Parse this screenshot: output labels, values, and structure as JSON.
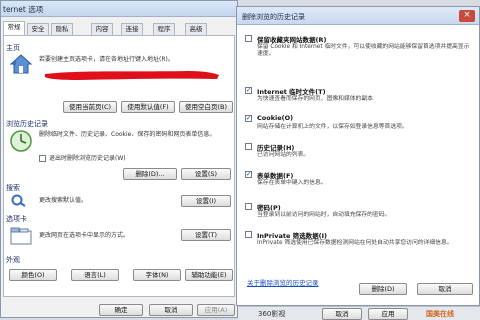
{
  "colors": {
    "desktop": "#d6dbe4",
    "window_bg": "#f0f0f0",
    "dialog_bg": "#ffffff",
    "title_bar": "#cfe0f5",
    "close_red": "#c74a3e",
    "red_scribble": "#e0101a",
    "link": "#1a4fbf",
    "taskbar": "#e4e7ec",
    "watermark": "#d1641f"
  },
  "options_window": {
    "title": "ternet 选项",
    "tabs": [
      "常规",
      "安全",
      "隐私",
      "内容",
      "连接",
      "程序",
      "高级"
    ],
    "home_page": {
      "label": "主页",
      "hint": "若要创建主页选项卡，请在各地址行键入地址(R)。",
      "buttons": [
        "使用当前页(C)",
        "使用默认值(F)",
        "使用空白页(B)"
      ]
    },
    "history": {
      "label": "浏览历史记录",
      "desc": "删除临时文件、历史记录、Cookie、保存的密码和网页表单信息。",
      "checkbox_label": "退出时删除浏览历史记录(W)",
      "checkbox_checked": false,
      "buttons": [
        "删除(D)...",
        "设置(S)"
      ]
    },
    "search": {
      "label": "搜索",
      "desc": "更改搜索默认值。",
      "button": "设置(I)"
    },
    "tabs_section": {
      "label": "选项卡",
      "desc": "更改网页在选项卡中显示的方式。",
      "button": "设置(T)"
    },
    "appearance": {
      "label": "外观",
      "buttons": [
        "颜色(O)",
        "语言(L)",
        "字体(N)",
        "辅助功能(E)"
      ]
    },
    "footer_buttons": [
      "确定",
      "取消",
      "应用(A)"
    ]
  },
  "delete_dialog": {
    "title": "删除浏览的历史记录",
    "close_glyph": "×",
    "options": [
      {
        "title": "保留收藏夹网站数据(R)",
        "desc": "保留 Cookie 和 Internet 临时文件，可以使收藏的网站能够保留首选项并提高显示速度。",
        "checked": false
      },
      {
        "title": "Internet 临时文件(T)",
        "desc": "为快速查看而保存的网页、图像和媒体的副本",
        "checked": true
      },
      {
        "title": "Cookie(O)",
        "desc": "网站存储在计算机上的文件，以保存如登录信息等首选项。",
        "checked": true
      },
      {
        "title": "历史记录(H)",
        "desc": "已访问网站的列表。",
        "checked": false
      },
      {
        "title": "表单数据(F)",
        "desc": "保存在表单中键入的信息。",
        "checked": true
      },
      {
        "title": "密码(P)",
        "desc": "当登录到以前访问的网站时，自动填充保存的密码。",
        "checked": false
      },
      {
        "title": "InPrivate 筛选数据(I)",
        "desc": "InPrivate 筛选使用已保存数据检测网站在何处自动共享您访问的详细信息。",
        "checked": false
      }
    ],
    "link": "关于删除浏览的历史记录",
    "buttons": [
      "删除(D)",
      "取消"
    ]
  },
  "taskbar": {
    "left_text": "360影视",
    "cancel_label": "取消",
    "apply_label": "应用",
    "watermark": "国美在线"
  },
  "icons": [
    "home-icon",
    "history-icon",
    "search-icon",
    "tabs-icon",
    "close-icon",
    "minimize-icon"
  ]
}
